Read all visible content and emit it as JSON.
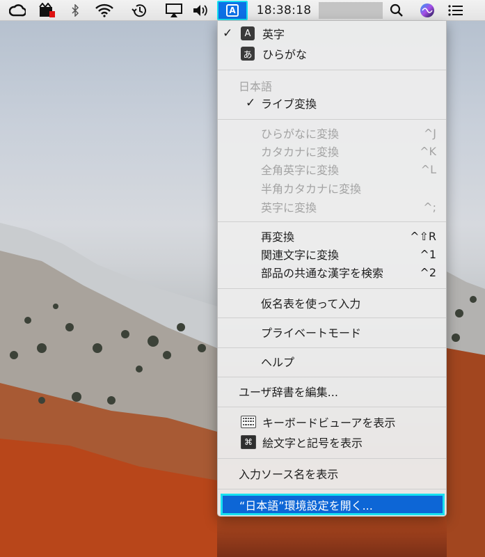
{
  "menubar": {
    "clock": "18:38:18",
    "input_mode_label": "A"
  },
  "menu": {
    "input_sources": [
      {
        "icon": "A",
        "label": "英字",
        "checked": true
      },
      {
        "icon": "あ",
        "label": "ひらがな",
        "checked": false
      }
    ],
    "section_header": "日本語",
    "live_conversion": {
      "label": "ライブ変換",
      "checked": true
    },
    "convert_items": [
      {
        "label": "ひらがなに変換",
        "shortcut": "^J"
      },
      {
        "label": "カタカナに変換",
        "shortcut": "^K"
      },
      {
        "label": "全角英字に変換",
        "shortcut": "^L"
      },
      {
        "label": "半角カタカナに変換",
        "shortcut": ""
      },
      {
        "label": "英字に変換",
        "shortcut": "^;"
      }
    ],
    "reconvert_items": [
      {
        "label": "再変換",
        "shortcut": "^⇧R"
      },
      {
        "label": "関連文字に変換",
        "shortcut": "^1"
      },
      {
        "label": "部品の共通な漢字を検索",
        "shortcut": "^2"
      }
    ],
    "kana_table": "仮名表を使って入力",
    "private_mode": "プライベートモード",
    "help": "ヘルプ",
    "edit_dictionary": "ユーザ辞書を編集...",
    "show_keyboard_viewer": "キーボードビューアを表示",
    "show_emoji": "絵文字と記号を表示",
    "show_source_name": "入力ソース名を表示",
    "open_preferences": "“日本語”環境設定を開く..."
  },
  "colors": {
    "highlight": "#0d66d6",
    "focus_ring": "#18e0f0"
  }
}
